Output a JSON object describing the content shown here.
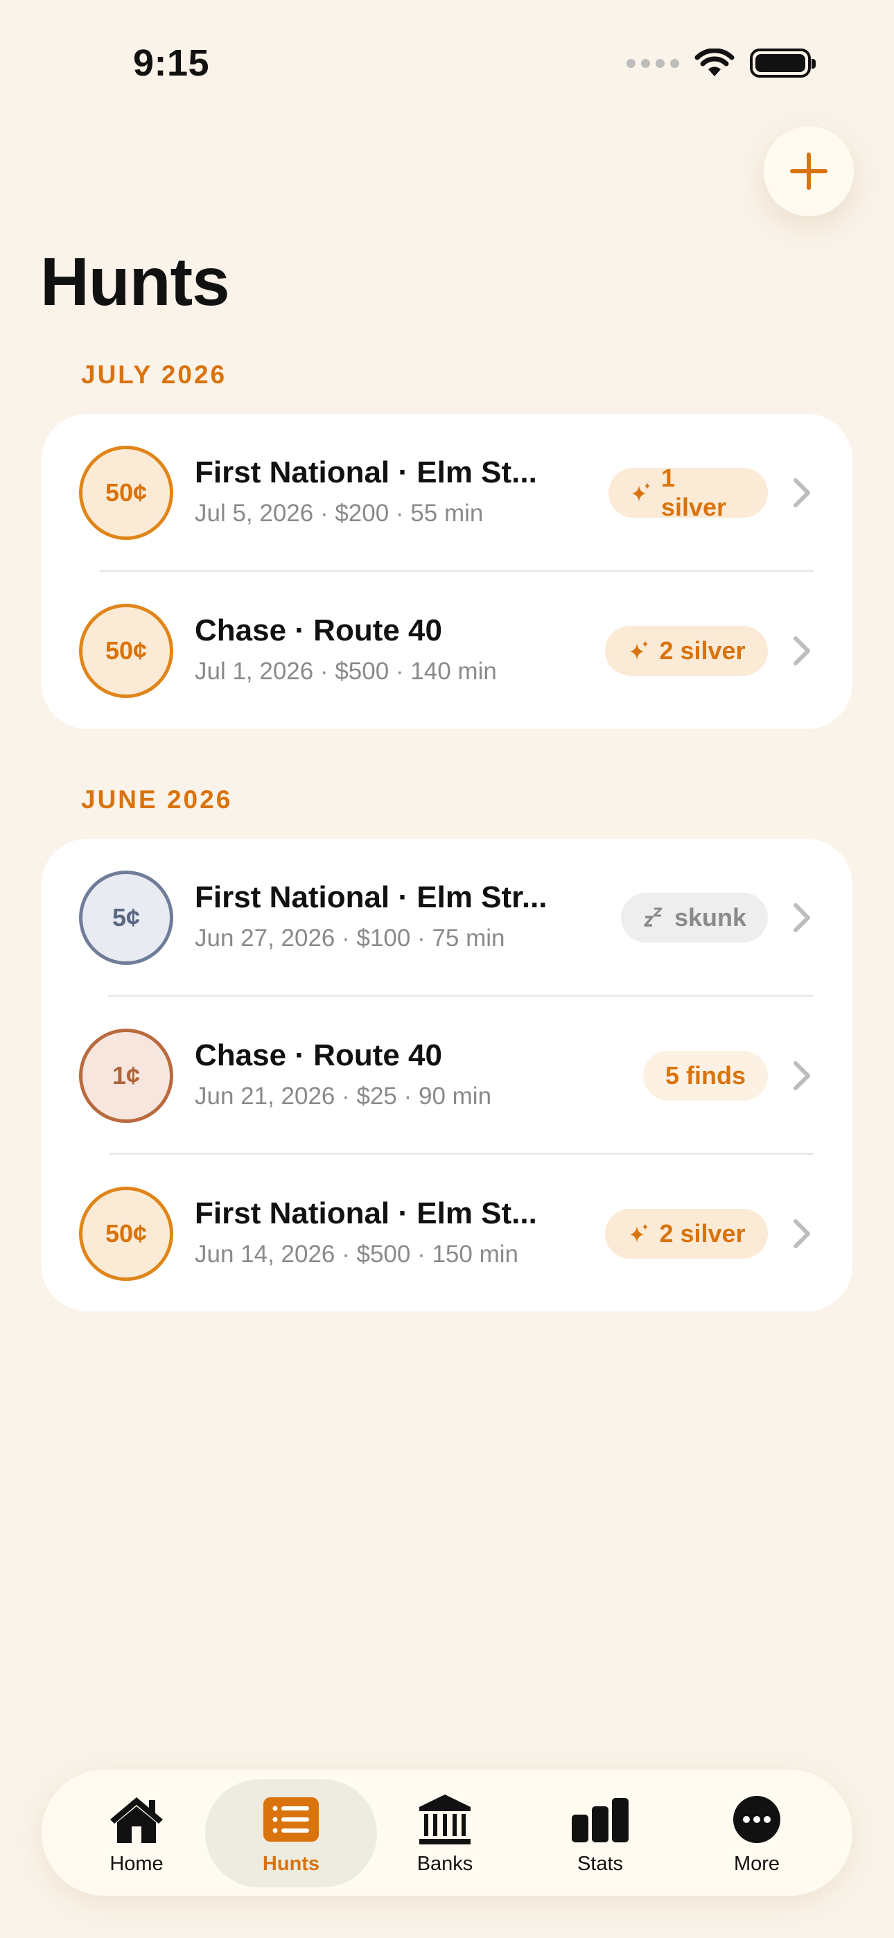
{
  "status_bar": {
    "time": "9:15"
  },
  "header": {
    "title": "Hunts",
    "add_button_icon": "plus-icon"
  },
  "colors": {
    "accent": "#D9730D",
    "background": "#FAF3E9",
    "card": "#FFFFFF"
  },
  "sections": [
    {
      "label": "JULY 2026",
      "hunts": [
        {
          "coin": "50¢",
          "title": "First National · Elm St...",
          "subtitle": "Jul 5, 2026 · $200 · 55 min",
          "badge": "1 silver",
          "badge_icon": "sparkle-icon"
        },
        {
          "coin": "50¢",
          "title": "Chase · Route 40",
          "subtitle": "Jul 1, 2026 · $500 · 140 min",
          "badge": "2 silver",
          "badge_icon": "sparkle-icon"
        }
      ]
    },
    {
      "label": "JUNE 2026",
      "hunts": [
        {
          "coin": "5¢",
          "title": "First National · Elm Str...",
          "subtitle": "Jun 27, 2026 · $100 · 75 min",
          "badge": "skunk",
          "badge_icon": "sleep-icon"
        },
        {
          "coin": "1¢",
          "title": "Chase · Route 40",
          "subtitle": "Jun 21, 2026 · $25 · 90 min",
          "badge": "5 finds",
          "badge_icon": ""
        },
        {
          "coin": "50¢",
          "title": "First National · Elm St...",
          "subtitle": "Jun 14, 2026 · $500 · 150 min",
          "badge": "2 silver",
          "badge_icon": "sparkle-icon"
        }
      ]
    }
  ],
  "tab_bar": {
    "active": "Hunts",
    "tabs": [
      {
        "label": "Home",
        "icon": "house-icon"
      },
      {
        "label": "Hunts",
        "icon": "list-icon"
      },
      {
        "label": "Banks",
        "icon": "bank-icon"
      },
      {
        "label": "Stats",
        "icon": "bar-chart-icon"
      },
      {
        "label": "More",
        "icon": "ellipsis-icon"
      }
    ]
  }
}
